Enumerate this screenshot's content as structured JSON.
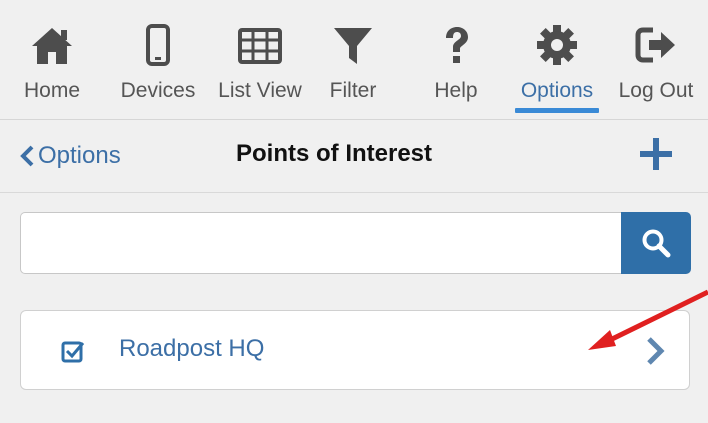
{
  "toolbar": {
    "items": [
      {
        "label": "Home",
        "icon": "home-icon"
      },
      {
        "label": "Devices",
        "icon": "mobile-icon"
      },
      {
        "label": "List View",
        "icon": "table-icon"
      },
      {
        "label": "Filter",
        "icon": "filter-icon"
      },
      {
        "label": "Help",
        "icon": "question-icon"
      },
      {
        "label": "Options",
        "icon": "gear-icon",
        "active": true
      },
      {
        "label": "Log Out",
        "icon": "sign-out-icon"
      }
    ]
  },
  "header": {
    "back_label": "Options",
    "title": "Points of Interest"
  },
  "search": {
    "value": "",
    "placeholder": ""
  },
  "list": {
    "items": [
      {
        "label": "Roadpost HQ",
        "checked": true
      }
    ]
  },
  "colors": {
    "accent": "#3c6fa6",
    "search_button": "#2f6fa8",
    "annotation_arrow": "#e02020"
  }
}
